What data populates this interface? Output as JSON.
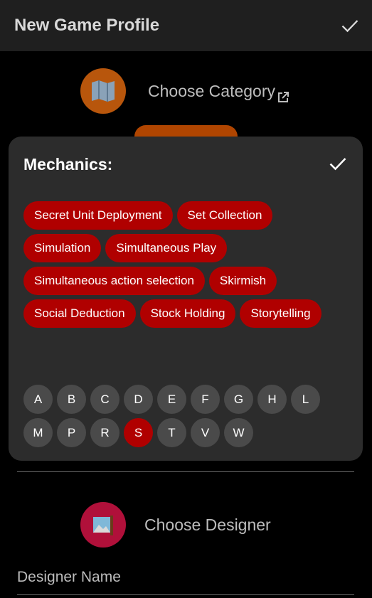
{
  "header": {
    "title": "New Game Profile",
    "confirm_icon": "check-icon"
  },
  "category": {
    "label": "Choose Category",
    "icon": "map-icon",
    "link_icon": "external-link-icon"
  },
  "designer": {
    "label": "Choose Designer",
    "icon": "picture-icon",
    "name_placeholder": "Designer Name"
  },
  "mechanics": {
    "title": "Mechanics:",
    "done_icon": "check-icon",
    "chip_rows": [
      [
        "Secret Unit Deployment",
        "Set Collection"
      ],
      [
        "Simulation",
        "Simultaneous Play"
      ],
      [
        "Simultaneous action selection",
        "Skirmish"
      ],
      [
        "Social Deduction",
        "Stock Holding",
        "Storytelling"
      ]
    ],
    "letter_rows": [
      [
        "A",
        "B",
        "C",
        "D",
        "E",
        "F",
        "G",
        "H",
        "L"
      ],
      [
        "M",
        "P",
        "R",
        "S",
        "T",
        "V",
        "W"
      ]
    ],
    "selected_letter": "S"
  },
  "colors": {
    "appbar": "#1f1f1f",
    "chip": "#b00000",
    "panel": "#2c2c2c",
    "letter": "#4a4a4a",
    "category_icon_bg": "#b8560c",
    "designer_icon_bg": "#b0103a"
  }
}
